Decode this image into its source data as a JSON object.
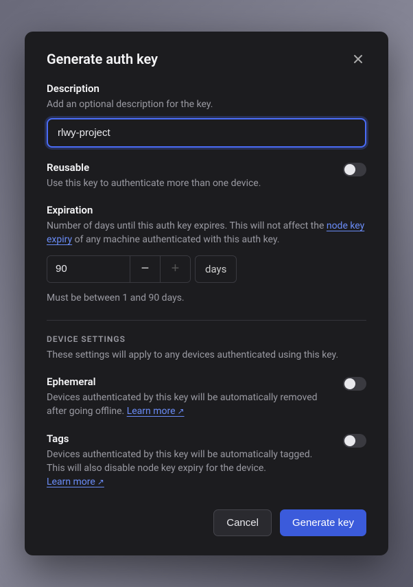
{
  "modal": {
    "title": "Generate auth key"
  },
  "description": {
    "label": "Description",
    "help": "Add an optional description for the key.",
    "value": "rlwy-project"
  },
  "reusable": {
    "label": "Reusable",
    "help": "Use this key to authenticate more than one device.",
    "enabled": false
  },
  "expiration": {
    "label": "Expiration",
    "help_prefix": "Number of days until this auth key expires. This will not affect the ",
    "help_link": "node key expiry",
    "help_suffix": " of any machine authenticated with this auth key.",
    "value": "90",
    "unit": "days",
    "constraint": "Must be between 1 and 90 days."
  },
  "device_settings": {
    "heading": "DEVICE SETTINGS",
    "help": "These settings will apply to any devices authenticated using this key."
  },
  "ephemeral": {
    "label": "Ephemeral",
    "help": "Devices authenticated by this key will be automatically removed after going offline. ",
    "learn_more": "Learn more",
    "enabled": false
  },
  "tags": {
    "label": "Tags",
    "help": "Devices authenticated by this key will be automatically tagged. This will also disable node key expiry for the device.",
    "learn_more": "Learn more",
    "enabled": false
  },
  "buttons": {
    "cancel": "Cancel",
    "generate": "Generate key"
  }
}
